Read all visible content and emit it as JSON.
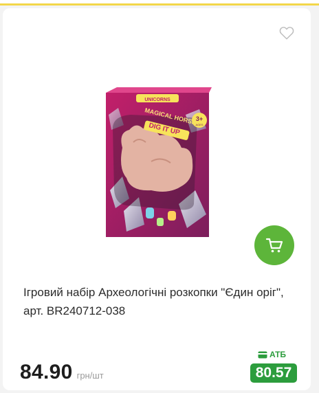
{
  "product": {
    "title": "Ігровий набір Археологічні розкопки \"Єдин оріг\", арт. BR240712-038",
    "image_alt": "Ігровий набір Археологічні розкопки \"Єдин оріг\"",
    "box_text": {
      "top_banner": "UNICORNS",
      "line1": "MAGICAL HORSE",
      "line2": "DIG IT UP",
      "age_badge": "3+",
      "age_sub": "AGES"
    }
  },
  "price": {
    "value": "84.90",
    "unit": "грн/шт"
  },
  "atb": {
    "label": "АТБ",
    "price": "80.57"
  },
  "icons": {
    "favorite": "heart-icon",
    "cart": "cart-icon",
    "atb": "card-icon"
  },
  "colors": {
    "accent_green": "#5db53a",
    "atb_green": "#2c9d3d",
    "top_stripe": "#f3d649"
  }
}
